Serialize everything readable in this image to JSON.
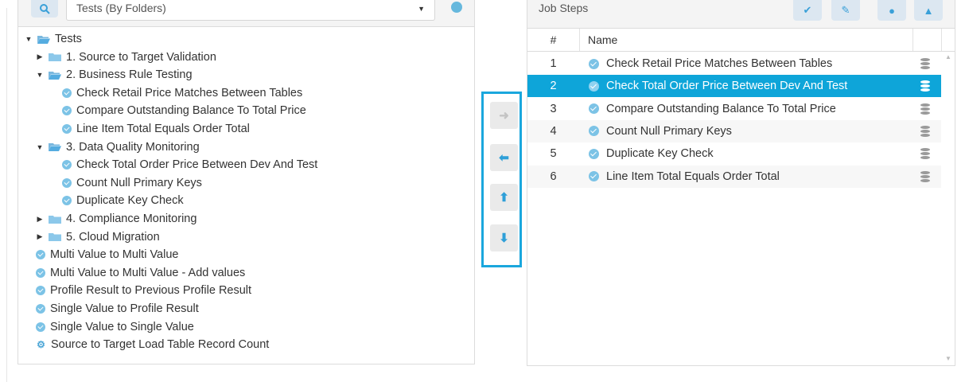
{
  "left_panel": {
    "select_value": "Tests (By Folders)",
    "tree": [
      {
        "label": "Tests",
        "kind": "folder-open",
        "level": 0,
        "caret": "expanded"
      },
      {
        "label": "1. Source to Target Validation",
        "kind": "folder",
        "level": 1,
        "caret": "collapsed"
      },
      {
        "label": "2. Business Rule Testing",
        "kind": "folder-open",
        "level": 1,
        "caret": "expanded"
      },
      {
        "label": "Check Retail Price Matches Between Tables",
        "kind": "check",
        "level": 2
      },
      {
        "label": "Compare Outstanding Balance To Total Price",
        "kind": "check",
        "level": 2
      },
      {
        "label": "Line Item Total Equals Order Total",
        "kind": "check",
        "level": 2
      },
      {
        "label": "3. Data Quality Monitoring",
        "kind": "folder-open",
        "level": 1,
        "caret": "expanded"
      },
      {
        "label": "Check Total Order Price Between Dev And Test",
        "kind": "check",
        "level": 2
      },
      {
        "label": "Count Null Primary Keys",
        "kind": "check",
        "level": 2
      },
      {
        "label": "Duplicate Key Check",
        "kind": "check",
        "level": 2
      },
      {
        "label": "4. Compliance Monitoring",
        "kind": "folder",
        "level": 1,
        "caret": "collapsed"
      },
      {
        "label": "5. Cloud Migration",
        "kind": "folder",
        "level": 1,
        "caret": "collapsed"
      },
      {
        "label": "Multi Value to Multi Value",
        "kind": "check",
        "level": 1
      },
      {
        "label": "Multi Value to Multi Value - Add values",
        "kind": "check",
        "level": 1
      },
      {
        "label": "Profile Result to Previous Profile Result",
        "kind": "check",
        "level": 1
      },
      {
        "label": "Single Value to Profile Result",
        "kind": "check",
        "level": 1
      },
      {
        "label": "Single Value to Single Value",
        "kind": "check",
        "level": 1
      },
      {
        "label": "Source to Target Load Table Record Count",
        "kind": "gear",
        "level": 1
      }
    ]
  },
  "move_buttons": [
    {
      "name": "move-right-button",
      "glyph": "➜",
      "color": "#c4c4c4"
    },
    {
      "name": "move-left-button",
      "glyph": "⬅",
      "color": "#2e9fd8"
    },
    {
      "name": "move-up-button",
      "glyph": "⬆",
      "color": "#2e9fd8"
    },
    {
      "name": "move-down-button",
      "glyph": "⬇",
      "color": "#2e9fd8"
    }
  ],
  "right_panel": {
    "title": "Job Steps",
    "columns": {
      "num": "#",
      "name": "Name"
    },
    "rows": [
      {
        "num": "1",
        "name": "Check Retail Price Matches Between Tables",
        "selected": false
      },
      {
        "num": "2",
        "name": "Check Total Order Price Between Dev And Test",
        "selected": true
      },
      {
        "num": "3",
        "name": "Compare Outstanding Balance To Total Price",
        "selected": false
      },
      {
        "num": "4",
        "name": "Count Null Primary Keys",
        "selected": false
      },
      {
        "num": "5",
        "name": "Duplicate Key Check",
        "selected": false
      },
      {
        "num": "6",
        "name": "Line Item Total Equals Order Total",
        "selected": false
      }
    ]
  },
  "colors": {
    "accent": "#0ea5d9",
    "highlight_border": "#1aa7dd"
  }
}
